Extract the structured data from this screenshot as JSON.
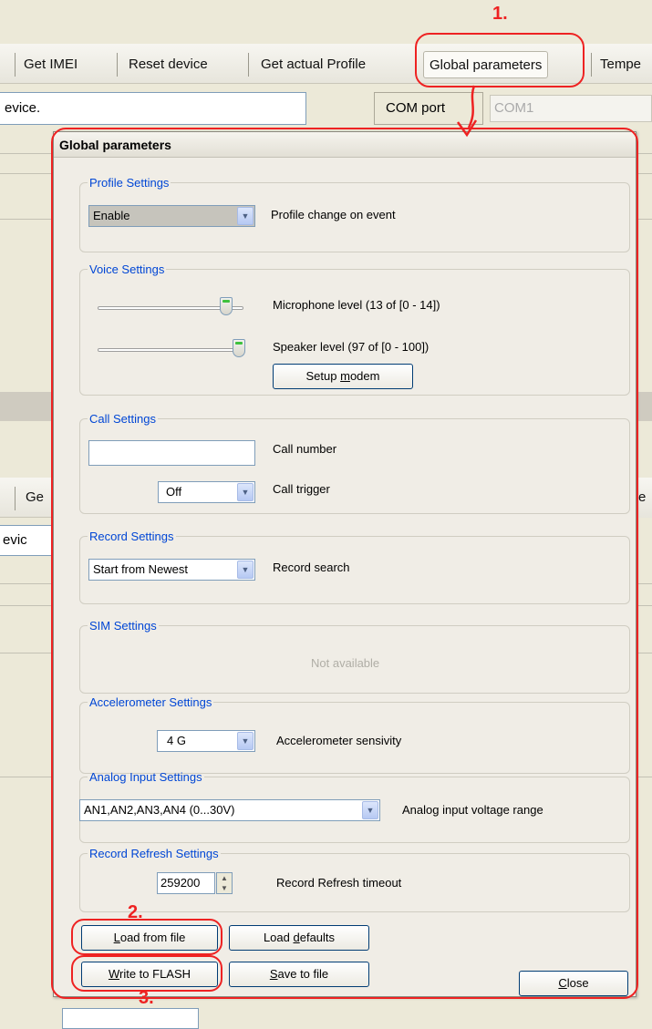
{
  "toolbar": {
    "items": [
      "Get IMEI",
      "Reset device",
      "Get actual Profile",
      "Global parameters",
      "Tempe"
    ]
  },
  "status": {
    "text": "evice.",
    "com_label": "COM port",
    "com_value": "COM1"
  },
  "background_cut": {
    "left_a": "Ge",
    "left_b": "evic",
    "right_a": "e"
  },
  "dialog": {
    "title": "Global parameters",
    "profile": {
      "legend": "Profile Settings",
      "value": "Enable",
      "label": "Profile change on event"
    },
    "voice": {
      "legend": "Voice Settings",
      "mic_label": "Microphone level (13 of [0 - 14])",
      "mic_level": 13,
      "mic_max": 14,
      "spk_label": "Speaker level (97 of [0 - 100])",
      "spk_level": 97,
      "spk_max": 100,
      "setup_prefix": "Setup ",
      "setup_underline": "m",
      "setup_suffix": "odem"
    },
    "call": {
      "legend": "Call Settings",
      "number_value": "",
      "number_label": "Call number",
      "trigger_value": "Off",
      "trigger_label": "Call trigger"
    },
    "record": {
      "legend": "Record Settings",
      "value": "Start from Newest",
      "label": "Record search"
    },
    "sim": {
      "legend": "SIM Settings",
      "status": "Not available"
    },
    "accel": {
      "legend": "Accelerometer Settings",
      "value": "4 G",
      "label": "Accelerometer sensivity"
    },
    "analog": {
      "legend": "Analog Input Settings",
      "value": "AN1,AN2,AN3,AN4 (0...30V)",
      "label": "Analog input voltage range"
    },
    "refresh": {
      "legend": "Record Refresh Settings",
      "value": "259200",
      "label": "Record Refresh timeout"
    },
    "buttons": {
      "load_file_u": "L",
      "load_file_rest": "oad from file",
      "load_defaults_pre": "Load ",
      "load_defaults_u": "d",
      "load_defaults_rest": "efaults",
      "write_flash_u": "W",
      "write_flash_rest": "rite to FLASH",
      "save_file_u": "S",
      "save_file_rest": "ave to file",
      "close_u": "C",
      "close_rest": "lose"
    }
  },
  "annotations": {
    "step1": "1.",
    "step2": "2.",
    "step3": "3."
  },
  "colors": {
    "annotation_red": "#e22222",
    "legend_blue": "#0046d5"
  }
}
